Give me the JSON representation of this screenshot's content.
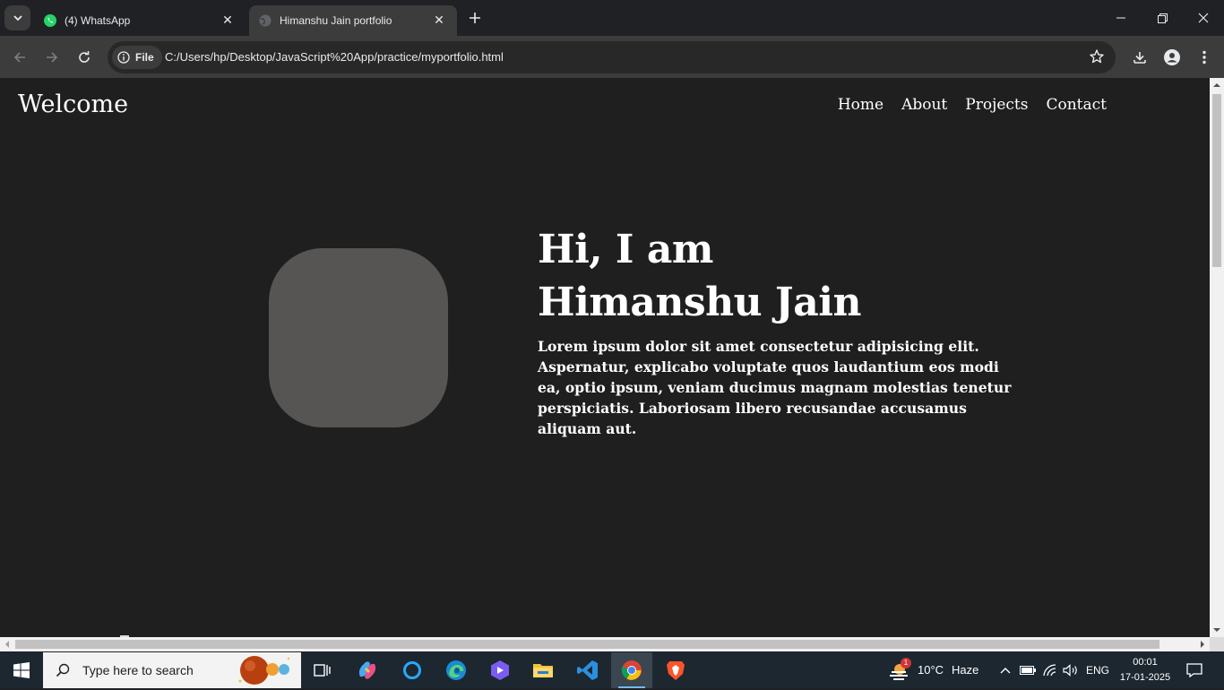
{
  "browser": {
    "tabs": [
      {
        "title": "(4) WhatsApp",
        "active": false,
        "favicon": "whatsapp-icon"
      },
      {
        "title": "Himanshu Jain portfolio",
        "active": true,
        "favicon": "globe-icon"
      }
    ],
    "site_chip_label": "File",
    "url": "C:/Users/hp/Desktop/JavaScript%20App/practice/myportfolio.html"
  },
  "page": {
    "brand": "Welcome",
    "nav": [
      "Home",
      "About",
      "Projects",
      "Contact"
    ],
    "hero": {
      "line1": "Hi, I am",
      "line2": "Himanshu Jain",
      "body": "Lorem ipsum dolor sit amet consectetur adipisicing elit. Aspernatur, explicabo voluptate quos laudantium eos modi ea, optio ipsum, veniam ducimus magnam molestias tenetur perspiciatis. Laboriosam libero recusandae accusamus aliquam aut."
    },
    "colors": {
      "background": "#1f1f1f",
      "avatar_placeholder": "#575554",
      "text": "#ffffff"
    }
  },
  "taskbar": {
    "search_placeholder": "Type here to search",
    "weather": {
      "temp": "10°C",
      "condition": "Haze",
      "badge": "1"
    },
    "language": "ENG",
    "time": "00:01",
    "date": "17-01-2025"
  }
}
